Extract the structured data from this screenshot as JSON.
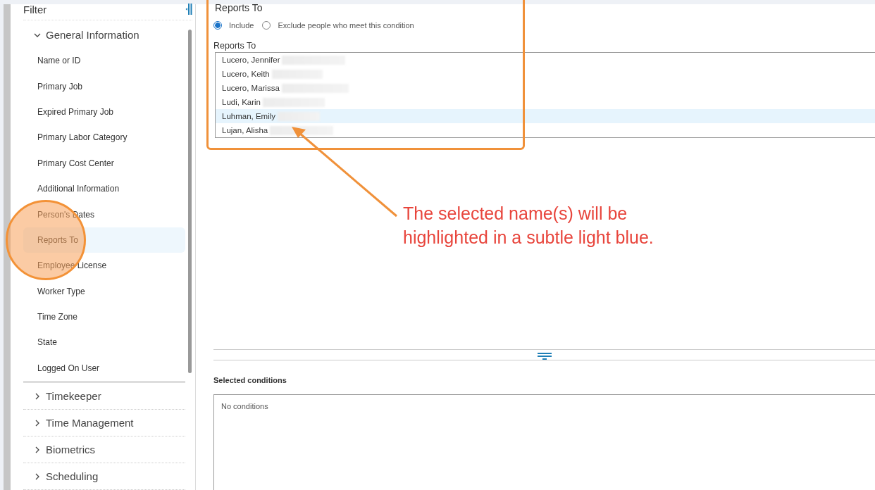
{
  "sidebar": {
    "title": "Filter",
    "sections": [
      {
        "label": "General Information",
        "expanded": true,
        "items": [
          {
            "label": "Name or ID",
            "selected": false
          },
          {
            "label": "Primary Job",
            "selected": false
          },
          {
            "label": "Expired Primary Job",
            "selected": false
          },
          {
            "label": "Primary Labor Category",
            "selected": false
          },
          {
            "label": "Primary Cost Center",
            "selected": false
          },
          {
            "label": "Additional Information",
            "selected": false
          },
          {
            "label": "Person's Dates",
            "selected": false
          },
          {
            "label": "Reports To",
            "selected": true
          },
          {
            "label": "Employee License",
            "selected": false
          },
          {
            "label": "Worker Type",
            "selected": false
          },
          {
            "label": "Time Zone",
            "selected": false
          },
          {
            "label": "State",
            "selected": false
          },
          {
            "label": "Logged On User",
            "selected": false
          }
        ]
      },
      {
        "label": "Timekeeper",
        "expanded": false
      },
      {
        "label": "Time Management",
        "expanded": false
      },
      {
        "label": "Biometrics",
        "expanded": false
      },
      {
        "label": "Scheduling",
        "expanded": false
      }
    ]
  },
  "condition": {
    "title": "Reports To",
    "options": [
      {
        "label": "Include",
        "selected": true
      },
      {
        "label": "Exclude people who meet this condition",
        "selected": false
      }
    ],
    "list_label": "Reports To",
    "people": [
      {
        "name": "Lucero, Jennifer",
        "selected": false
      },
      {
        "name": "Lucero, Keith",
        "selected": false
      },
      {
        "name": "Lucero, Marissa",
        "selected": false
      },
      {
        "name": "Ludi, Karin",
        "selected": false
      },
      {
        "name": "Luhman, Emily",
        "selected": true
      },
      {
        "name": "Lujan, Alisha",
        "selected": false
      }
    ]
  },
  "selected_conditions": {
    "title": "Selected conditions",
    "placeholder": "No conditions"
  },
  "annotation": {
    "text": "The selected name(s) will be highlighted in a subtle light blue."
  }
}
